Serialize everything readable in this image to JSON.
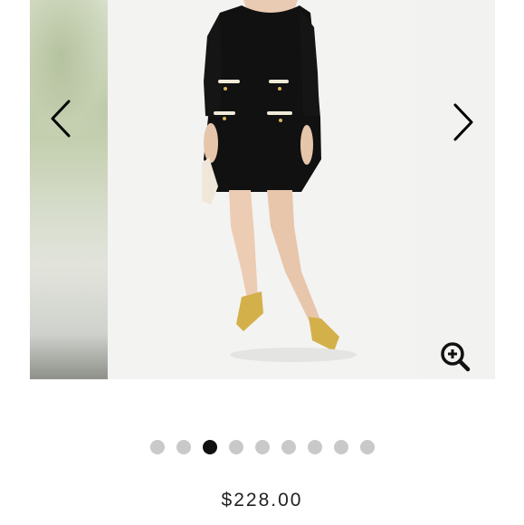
{
  "product": {
    "price": "$228.00"
  },
  "carousel": {
    "image_count": 9,
    "active_index": 2,
    "prev_icon": "chevron-left-icon",
    "next_icon": "chevron-right-icon",
    "zoom_icon": "zoom-in-icon"
  },
  "colors": {
    "dress": "#111111",
    "trim": "#f0ead8",
    "shoes": "#d4b04a",
    "dot_inactive": "#c9c9c9",
    "dot_active": "#111111"
  }
}
